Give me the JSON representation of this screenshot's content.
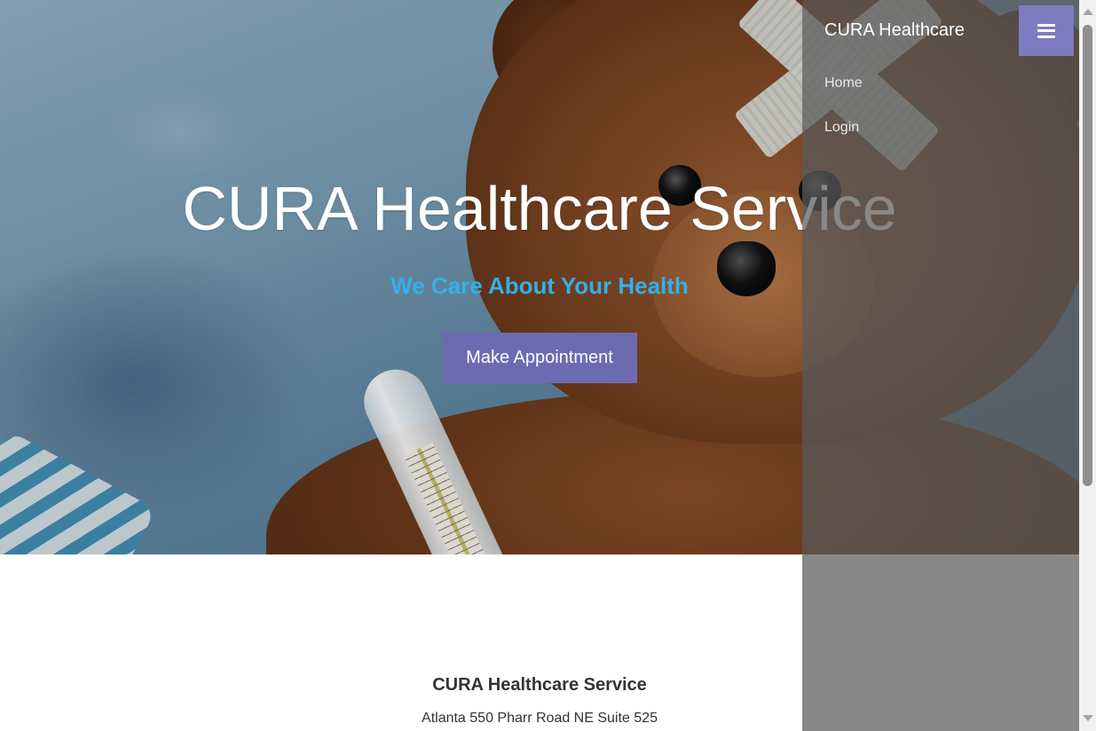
{
  "hero": {
    "title": "CURA Healthcare Service",
    "subtitle": "We Care About Your Health",
    "appointment_button": "Make Appointment"
  },
  "sidebar": {
    "brand": "CURA Healthcare",
    "items": [
      {
        "label": "Home"
      },
      {
        "label": "Login"
      }
    ],
    "menu_icon": "hamburger-icon"
  },
  "footer": {
    "title": "CURA Healthcare Service",
    "address": "Atlanta 550 Pharr Road NE Suite 525"
  },
  "colors": {
    "accent": "#6c6bb2",
    "subtitle": "#33b0ea"
  }
}
